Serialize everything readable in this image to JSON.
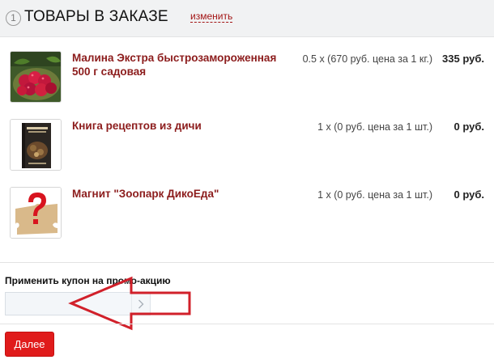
{
  "header": {
    "step_number": "1",
    "title": "ТОВАРЫ В ЗАКАЗЕ",
    "edit_link": "изменить"
  },
  "items": [
    {
      "name": "Малина Экстра быстрозамороженная 500 г садовая",
      "quantity": "0.5 x (670 руб. цена за 1 кг.)",
      "price": "335 руб."
    },
    {
      "name": "Книга рецептов из дичи",
      "quantity": "1 x (0 руб. цена за 1 шт.)",
      "price": "0 руб."
    },
    {
      "name": "Магнит \"Зоопарк ДикоЕда\"",
      "quantity": "1 x (0 руб. цена за 1 шт.)",
      "price": "0 руб."
    }
  ],
  "coupon": {
    "label": "Применить купон на промо-акцию",
    "value": "",
    "placeholder": ""
  },
  "actions": {
    "next_label": "Далее"
  },
  "colors": {
    "accent": "#e01b1b",
    "product_name": "#8c1c1c",
    "header_bg": "#f1f2f3",
    "annotation_arrow": "#d1202a"
  }
}
